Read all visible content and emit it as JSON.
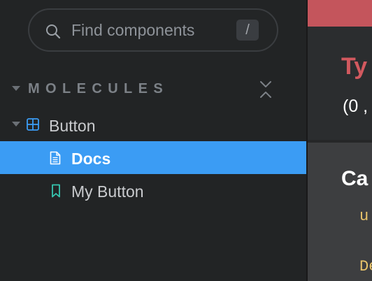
{
  "sidebar": {
    "search": {
      "placeholder": "Find components",
      "shortcut": "/",
      "icon": "search-icon"
    },
    "group": {
      "title": "MOLECULES",
      "expanded": true,
      "icons": {
        "caret": "caret-down-icon",
        "collapse": "collapse-all-icon"
      }
    },
    "tree": [
      {
        "label": "Button",
        "type": "component",
        "icon": "component-grid-icon",
        "expanded": true
      },
      {
        "label": "Docs",
        "type": "docs",
        "icon": "document-icon",
        "selected": true
      },
      {
        "label": "My Button",
        "type": "story",
        "icon": "bookmark-icon",
        "selected": false
      }
    ]
  },
  "preview": {
    "heading": "Ty",
    "signature": "(0 ,",
    "section_heading": "Ca",
    "code_line_1": "u",
    "code_line_2": "De"
  },
  "colors": {
    "sidebar_bg": "#222425",
    "selected_bg": "#3b9cf4",
    "group_title": "#7c8187",
    "component_icon": "#3b9cf4",
    "story_icon": "#36c6b0",
    "error_red": "#c4555c",
    "code_yellow": "#e8c36a"
  }
}
